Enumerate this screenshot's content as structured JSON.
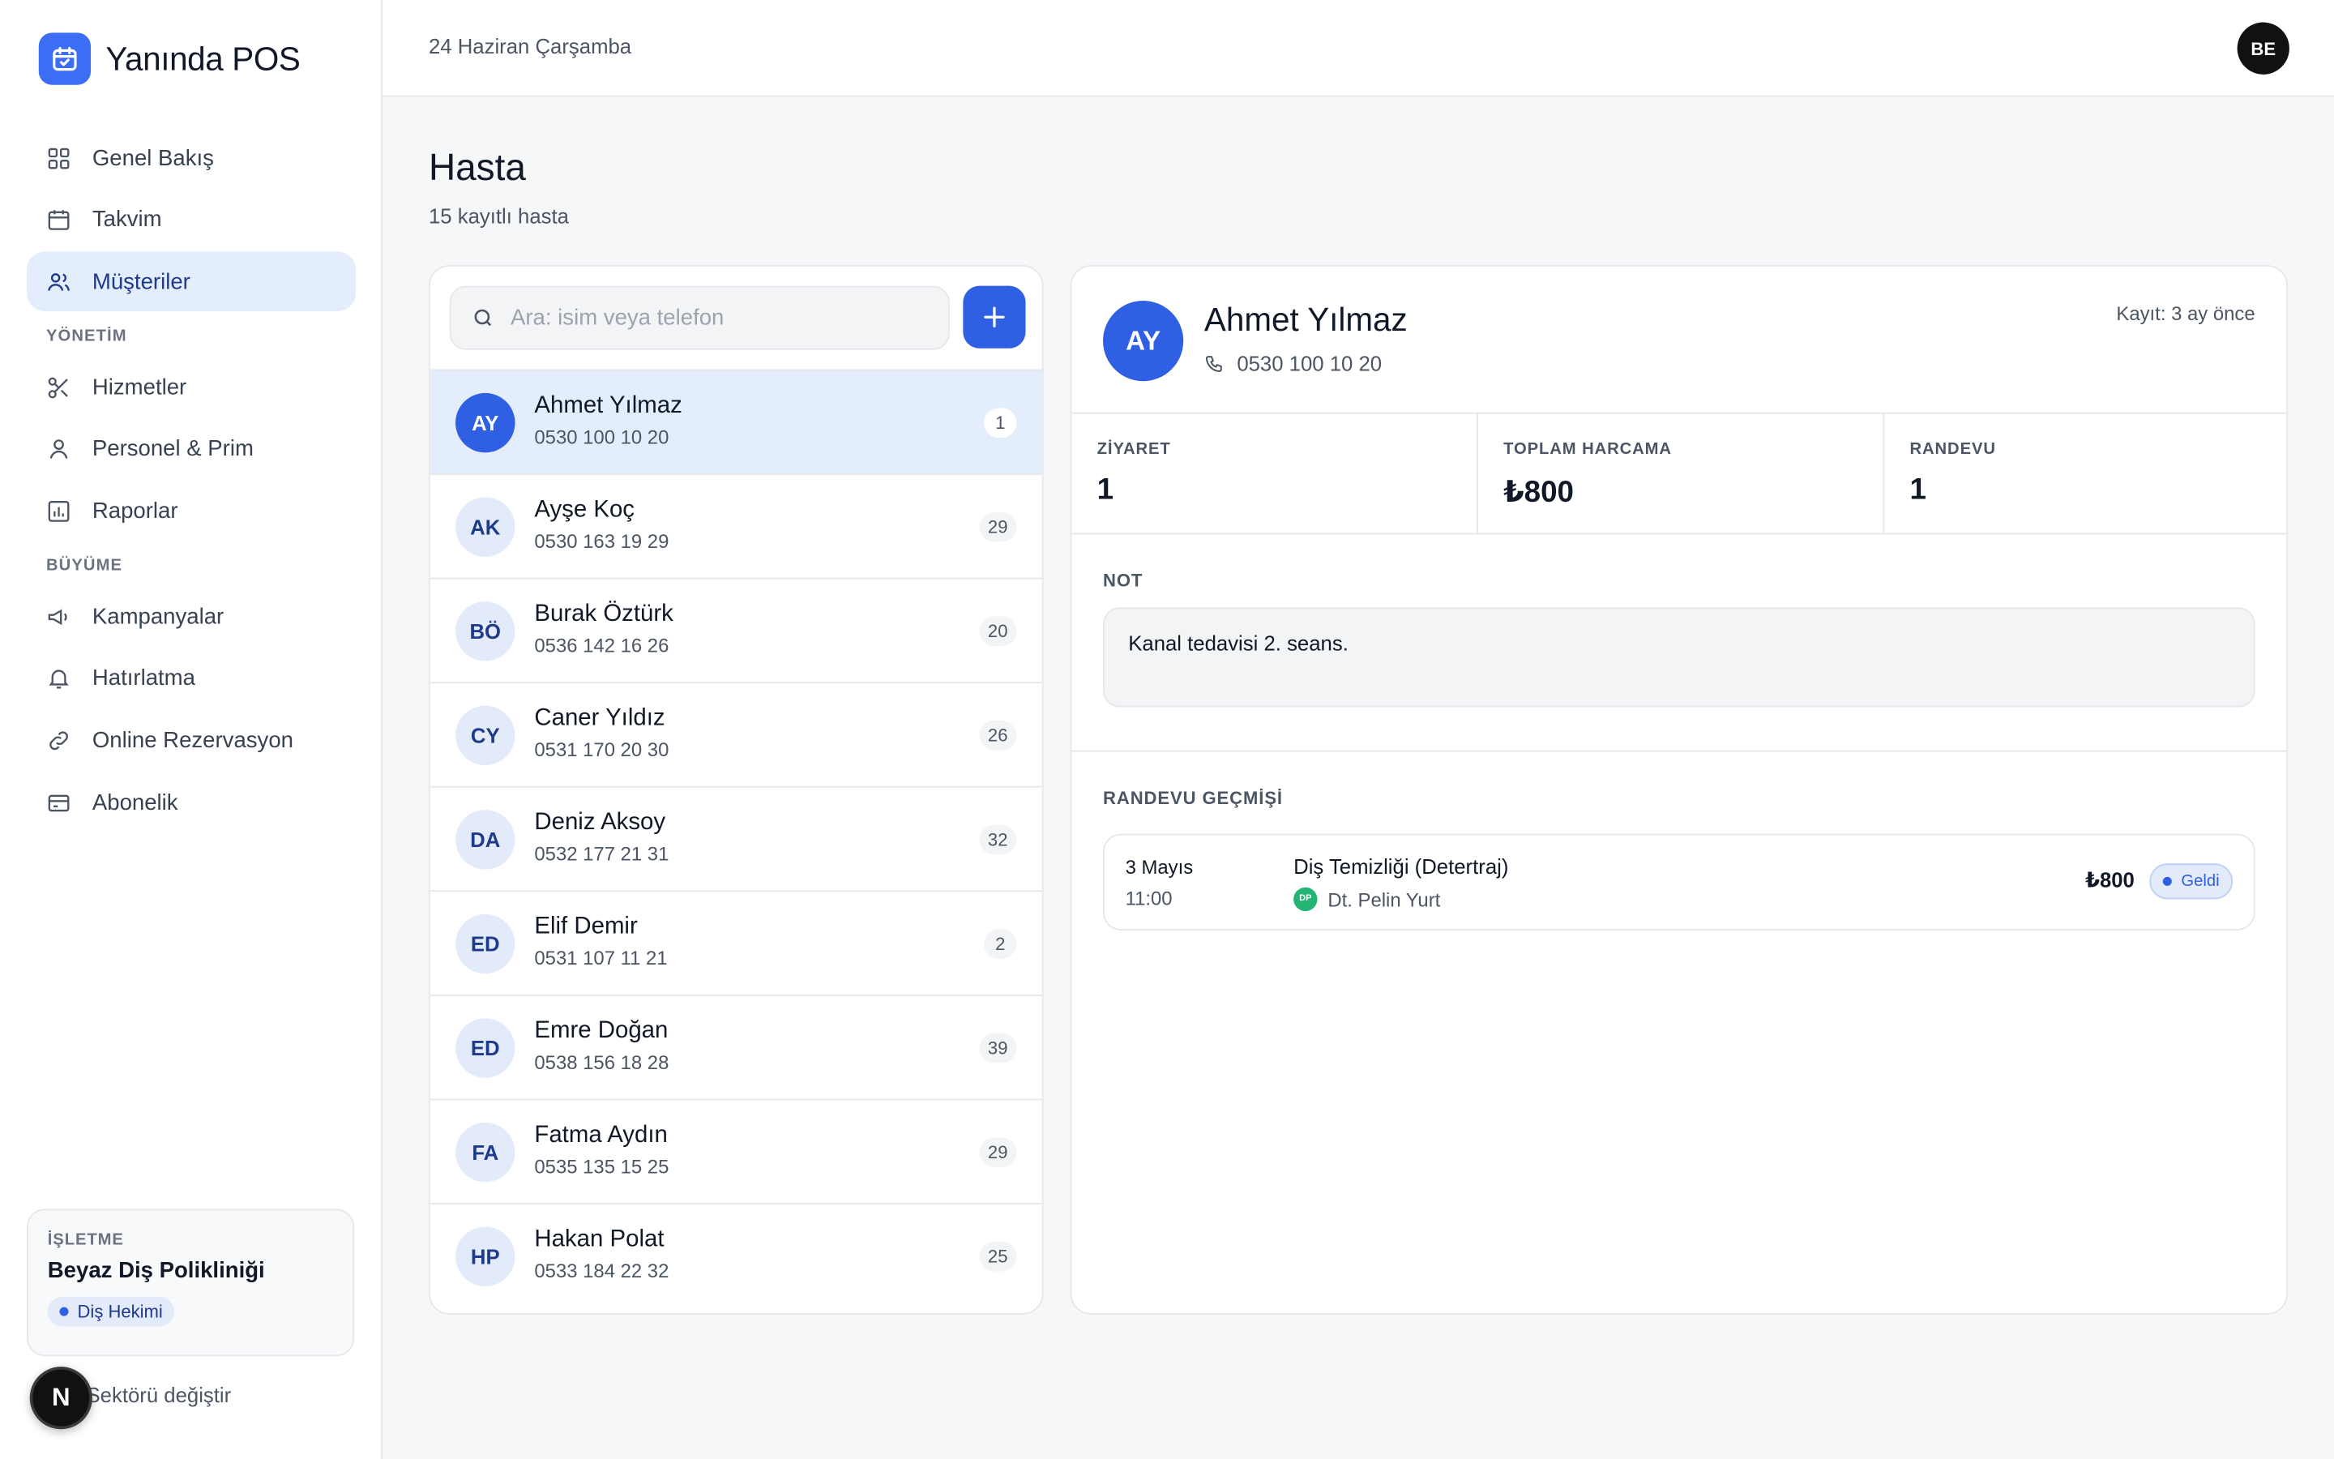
{
  "brand": {
    "name": "Yanında POS"
  },
  "sidebar": {
    "items": [
      {
        "label": "Genel Bakış",
        "icon": "grid-icon"
      },
      {
        "label": "Takvim",
        "icon": "calendar-icon"
      },
      {
        "label": "Müşteriler",
        "icon": "users-icon",
        "active": true
      }
    ],
    "section_management": "YÖNETİM",
    "management_items": [
      {
        "label": "Hizmetler",
        "icon": "scissors-icon"
      },
      {
        "label": "Personel & Prim",
        "icon": "user-icon"
      },
      {
        "label": "Raporlar",
        "icon": "bar-chart-icon"
      }
    ],
    "section_growth": "BÜYÜME",
    "growth_items": [
      {
        "label": "Kampanyalar",
        "icon": "megaphone-icon"
      },
      {
        "label": "Hatırlatma",
        "icon": "bell-icon"
      },
      {
        "label": "Online Rezervasyon",
        "icon": "link-icon"
      },
      {
        "label": "Abonelik",
        "icon": "credit-card-icon"
      }
    ],
    "business": {
      "label": "İŞLETME",
      "name": "Beyaz Diş Polikliniği",
      "sector": "Diş Hekimi"
    },
    "sector_switch": "Sektörü değiştir",
    "n_badge": "N"
  },
  "topbar": {
    "date": "24 Haziran Çarşamba",
    "user_initials": "BE"
  },
  "page": {
    "title": "Hasta",
    "subtitle": "15 kayıtlı hasta"
  },
  "search": {
    "placeholder": "Ara: isim veya telefon",
    "value": ""
  },
  "patients": [
    {
      "initials": "AY",
      "name": "Ahmet Yılmaz",
      "phone": "0530 100 10 20",
      "count": "1",
      "selected": true
    },
    {
      "initials": "AK",
      "name": "Ayşe Koç",
      "phone": "0530 163 19 29",
      "count": "29"
    },
    {
      "initials": "BÖ",
      "name": "Burak Öztürk",
      "phone": "0536 142 16 26",
      "count": "20"
    },
    {
      "initials": "CY",
      "name": "Caner Yıldız",
      "phone": "0531 170 20 30",
      "count": "26"
    },
    {
      "initials": "DA",
      "name": "Deniz Aksoy",
      "phone": "0532 177 21 31",
      "count": "32"
    },
    {
      "initials": "ED",
      "name": "Elif Demir",
      "phone": "0531 107 11 21",
      "count": "2"
    },
    {
      "initials": "ED",
      "name": "Emre Doğan",
      "phone": "0538 156 18 28",
      "count": "39"
    },
    {
      "initials": "FA",
      "name": "Fatma Aydın",
      "phone": "0535 135 15 25",
      "count": "29"
    },
    {
      "initials": "HP",
      "name": "Hakan Polat",
      "phone": "0533 184 22 32",
      "count": "25"
    }
  ],
  "detail": {
    "initials": "AY",
    "name": "Ahmet Yılmaz",
    "phone": "0530 100 10 20",
    "registered": "Kayıt: 3 ay önce",
    "stats": [
      {
        "label": "ZİYARET",
        "value": "1"
      },
      {
        "label": "TOPLAM HARCAMA",
        "value": "₺800"
      },
      {
        "label": "RANDEVU",
        "value": "1"
      }
    ],
    "note_label": "NOT",
    "note": "Kanal tedavisi 2. seans.",
    "history_label": "RANDEVU GEÇMİŞİ",
    "appointments": [
      {
        "date": "3 Mayıs",
        "time": "11:00",
        "service": "Diş Temizliği (Detertraj)",
        "staff_initials": "DP",
        "staff": "Dt. Pelin Yurt",
        "price": "₺800",
        "status": "Geldi"
      }
    ]
  },
  "colors": {
    "accent": "#2f5fe3",
    "active_bg": "#e3edfc",
    "badge_bg": "#e3ebfb",
    "success": "#22b573"
  }
}
